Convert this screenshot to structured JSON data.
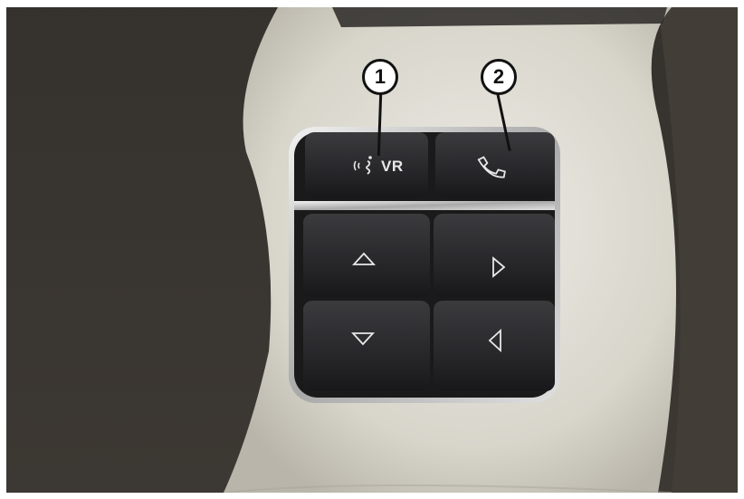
{
  "callouts": [
    {
      "number": "1"
    },
    {
      "number": "2"
    }
  ],
  "buttons": {
    "vr_label": "VR"
  },
  "icons": [
    "voice-recognition-icon",
    "phone-icon",
    "up-arrow-icon",
    "right-arrow-icon",
    "down-arrow-icon",
    "left-arrow-icon"
  ],
  "colors": {
    "leather": "#3a3530",
    "trim": "#dcd9cf",
    "button": "#2a2a2c",
    "chrome": "#c9c9c9"
  }
}
